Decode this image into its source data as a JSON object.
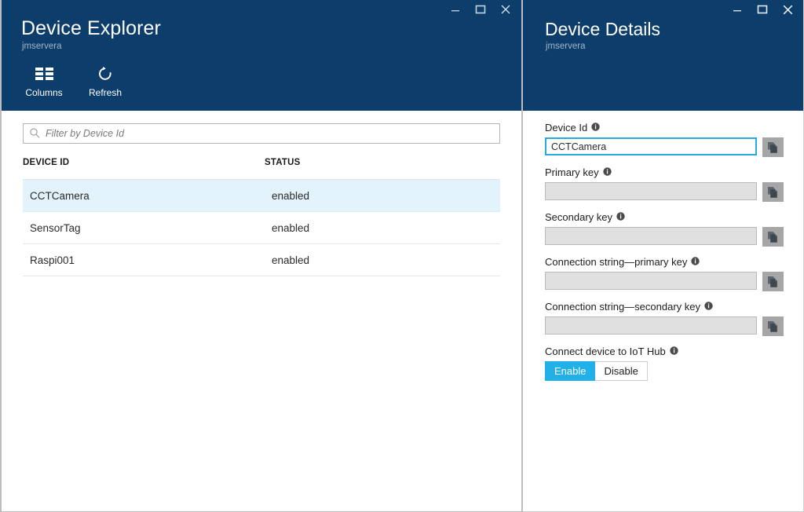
{
  "explorer": {
    "title": "Device Explorer",
    "subtitle": "jmservera",
    "window_controls": {
      "minimize": "minimize-icon",
      "maximize": "maximize-icon",
      "close": "close-icon"
    },
    "toolbar": [
      {
        "label": "Columns",
        "icon": "columns-grid-icon"
      },
      {
        "label": "Refresh",
        "icon": "refresh-icon"
      }
    ],
    "filter": {
      "placeholder": "Filter by Device Id",
      "value": "",
      "icon": "search-icon"
    },
    "table": {
      "columns": [
        "DEVICE ID",
        "STATUS"
      ],
      "rows": [
        {
          "device_id": "CCTCamera",
          "status": "enabled",
          "selected": true
        },
        {
          "device_id": "SensorTag",
          "status": "enabled",
          "selected": false
        },
        {
          "device_id": "Raspi001",
          "status": "enabled",
          "selected": false
        }
      ]
    }
  },
  "details": {
    "title": "Device Details",
    "subtitle": "jmservera",
    "window_controls": {
      "minimize": "minimize-icon",
      "maximize": "maximize-icon",
      "close": "close-icon"
    },
    "fields": [
      {
        "label": "Device Id",
        "value": "CCTCamera",
        "focused": true,
        "copy": "copy-icon"
      },
      {
        "label": "Primary key",
        "value": "",
        "focused": false,
        "copy": "copy-icon"
      },
      {
        "label": "Secondary key",
        "value": "",
        "focused": false,
        "copy": "copy-icon"
      },
      {
        "label": "Connection string—primary key",
        "value": "",
        "focused": false,
        "copy": "copy-icon"
      },
      {
        "label": "Connection string—secondary key",
        "value": "",
        "focused": false,
        "copy": "copy-icon"
      }
    ],
    "connect": {
      "label": "Connect device to IoT Hub",
      "enable_label": "Enable",
      "disable_label": "Disable",
      "selected": "Enable"
    }
  },
  "colors": {
    "header_blue": "#0c3d6b",
    "accent_cyan": "#21b0e8",
    "row_selected": "#e3f3fb",
    "field_disabled": "#e0e0e0",
    "copy_button": "#a6a6a6"
  }
}
